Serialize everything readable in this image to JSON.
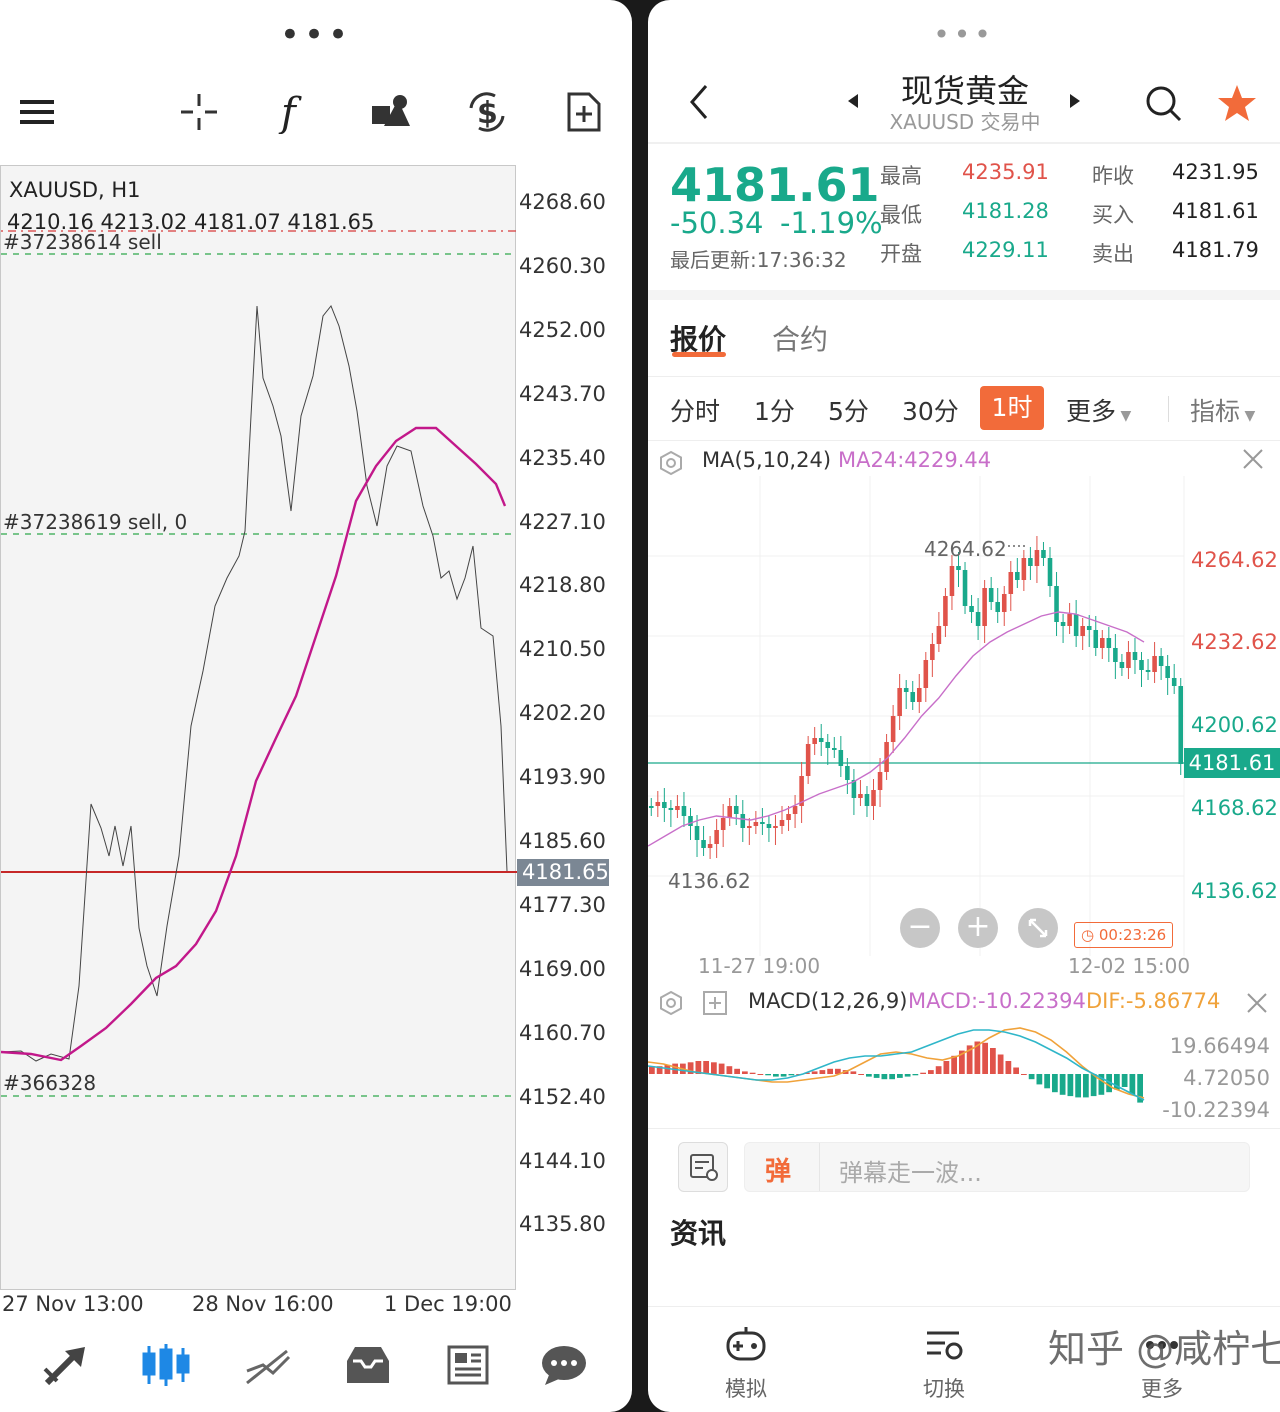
{
  "left": {
    "symbol": "XAUUSD, H1",
    "ohlc": "4210.16 4213.02 4181.07 4181.65",
    "order1": "#37238614 sell",
    "order2": "#37238619 sell, 0",
    "order3": "#366328",
    "y_axis": [
      "4268.60",
      "4260.30",
      "4252.00",
      "4243.70",
      "4235.40",
      "4227.10",
      "4218.80",
      "4210.50",
      "4202.20",
      "4193.90",
      "4185.60",
      "4177.30",
      "4169.00",
      "4160.70",
      "4152.40",
      "4144.10",
      "4135.80"
    ],
    "current_price": "4181.65",
    "x_axis": [
      "27 Nov 13:00",
      "28 Nov 16:00",
      "1 Dec 19:00"
    ],
    "toolbar_icons": [
      "menu-icon",
      "crosshair-icon",
      "function-icon",
      "objects-icon",
      "currency-icon",
      "new-order-icon"
    ],
    "bottom_icons": [
      "trade-icon",
      "chart-icon",
      "trendline-icon",
      "inbox-icon",
      "news-icon",
      "chat-icon"
    ]
  },
  "right": {
    "title": "现货黄金",
    "subtitle": "XAUUSD 交易中",
    "price": "4181.61",
    "change": "-50.34",
    "change_pct": "-1.19%",
    "last_update": "最后更新:17:36:32",
    "stats": [
      {
        "label": "最高",
        "value": "4235.91",
        "color": "#e0534a"
      },
      {
        "label": "最低",
        "value": "4181.28",
        "color": "#19a98b"
      },
      {
        "label": "开盘",
        "value": "4229.11",
        "color": "#19a98b"
      },
      {
        "label": "昨收",
        "value": "4231.95",
        "color": "#222"
      },
      {
        "label": "买入",
        "value": "4181.61",
        "color": "#222"
      },
      {
        "label": "卖出",
        "value": "4181.79",
        "color": "#222"
      }
    ],
    "tabs": [
      "报价",
      "合约"
    ],
    "periods": [
      "分时",
      "1分",
      "5分",
      "30分",
      "1时",
      "更多"
    ],
    "active_period": "1时",
    "indicator_label": "指标",
    "ma_label": "MA(5,10,24)",
    "ma_value": "MA24:4229.44",
    "kline_high": "4264.62",
    "kline_low": "4136.62",
    "price_axis": [
      "4264.62",
      "4232.62",
      "4200.62",
      "4168.62",
      "4136.62"
    ],
    "price_axis_colors": [
      "#e0534a",
      "#e0534a",
      "#19a98b",
      "#19a98b",
      "#19a98b"
    ],
    "last_price_tag": "4181.61",
    "countdown": "00:23:26",
    "time_axis": [
      "11-27 19:00",
      "12-02 15:00"
    ],
    "macd_label": "MACD(12,26,9)",
    "macd_value": "MACD:-10.22394",
    "dif_value": "DIF:-5.86774",
    "macd_axis": [
      "19.66494",
      "4.72050",
      "-10.22394"
    ],
    "danmu_placeholder": "弹幕走一波...",
    "danmu_badge": "弹",
    "news_title": "资讯",
    "nav": [
      {
        "label": "模拟",
        "icon": "gamepad-icon"
      },
      {
        "label": "切换",
        "icon": "switch-icon"
      },
      {
        "label": "更多",
        "icon": "more-icon"
      }
    ],
    "watermark": "知乎 @咸柠七",
    "colors": {
      "up": "#e0534a",
      "down": "#19a98b",
      "accent": "#f26b3a",
      "ma": "#c86fc9"
    }
  }
}
